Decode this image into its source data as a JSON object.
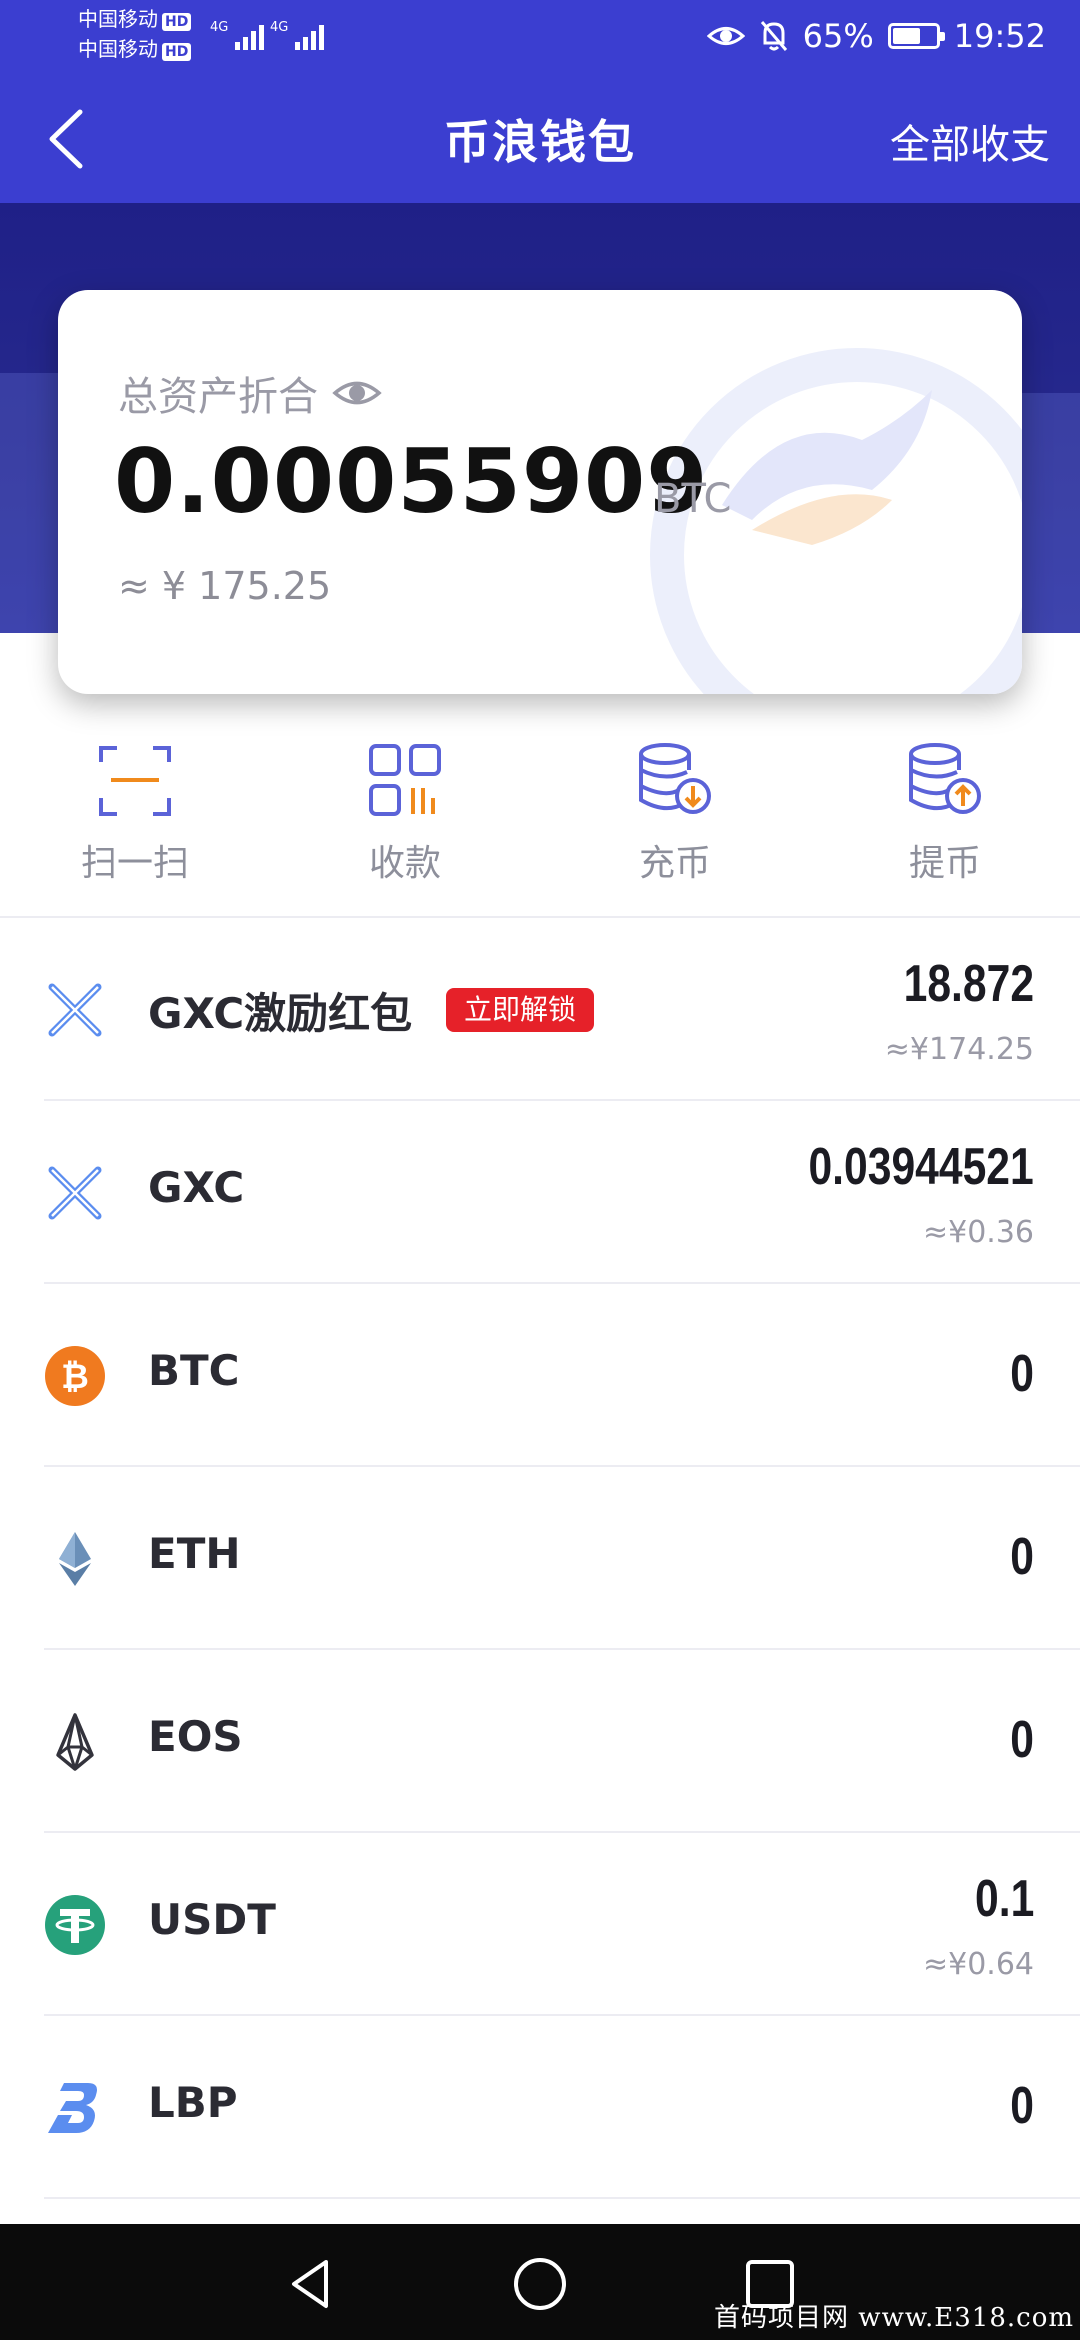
{
  "status_bar": {
    "carrier1": "中国移动",
    "carrier2": "中国移动",
    "hd": "HD",
    "net": "4G",
    "battery": "65%",
    "battery_level": 0.65,
    "time": "19:52"
  },
  "nav": {
    "title": "币浪钱包",
    "right": "全部收支"
  },
  "card": {
    "label": "总资产折合",
    "amount": "0.00055909",
    "unit": "BTC",
    "cny": "≈ ¥ 175.25"
  },
  "actions": [
    {
      "label": "扫一扫",
      "icon": "scan-icon"
    },
    {
      "label": "收款",
      "icon": "qr-code-icon"
    },
    {
      "label": "充币",
      "icon": "deposit-coins-icon"
    },
    {
      "label": "提币",
      "icon": "withdraw-coins-icon"
    }
  ],
  "tokens": [
    {
      "name": "GXC激励红包",
      "badge": "立即解锁",
      "value": "18.872",
      "sub": "≈¥174.25",
      "icon": "gxc-icon"
    },
    {
      "name": "GXC",
      "value": "0.03944521",
      "sub": "≈¥0.36",
      "icon": "gxc-icon"
    },
    {
      "name": "BTC",
      "value": "0",
      "icon": "btc-icon"
    },
    {
      "name": "ETH",
      "value": "0",
      "icon": "eth-icon"
    },
    {
      "name": "EOS",
      "value": "0",
      "icon": "eos-icon"
    },
    {
      "name": "USDT",
      "value": "0.1",
      "sub": "≈¥0.64",
      "icon": "usdt-icon"
    },
    {
      "name": "LBP",
      "value": "0",
      "icon": "lbp-icon"
    }
  ],
  "watermark": "首码项目网 www.E318.com",
  "colors": {
    "primary": "#3b3ed0",
    "badge": "#e62129",
    "icon_blue": "#5b63d8",
    "icon_orange": "#f08a1c"
  }
}
